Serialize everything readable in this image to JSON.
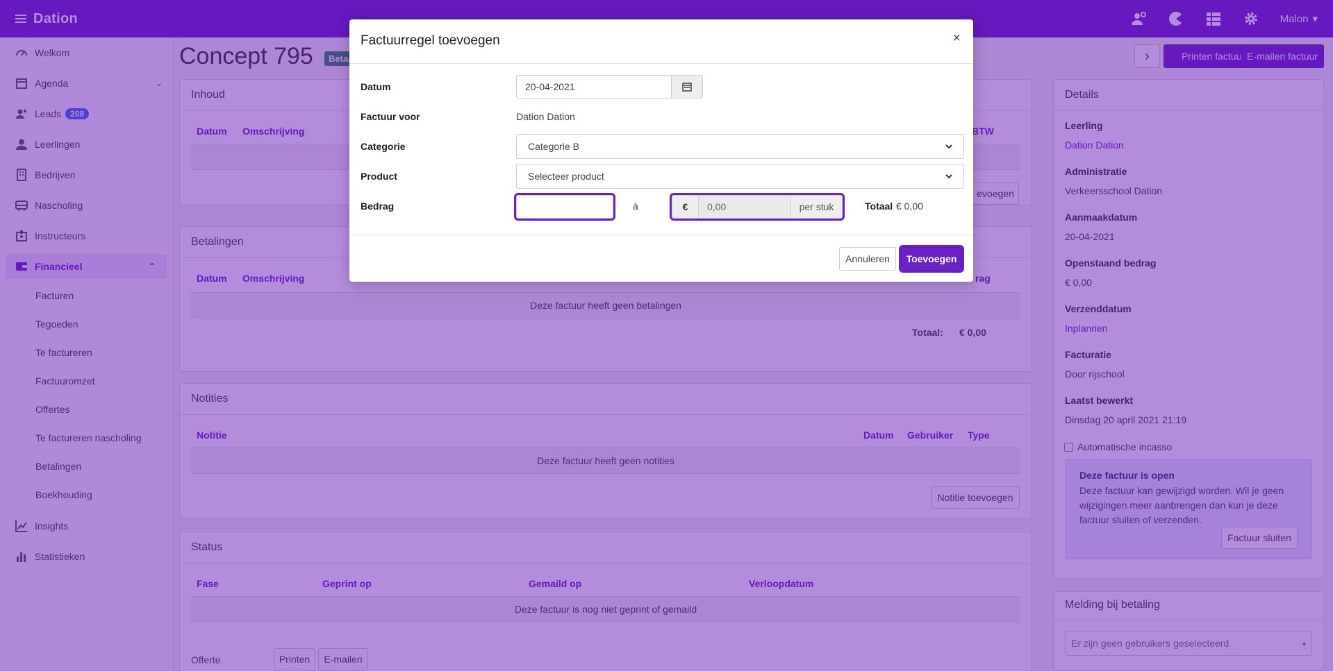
{
  "app": {
    "brand": "Dation",
    "user": "Malon"
  },
  "icons": {
    "menu": "hamburger-icon",
    "top": [
      "user-settings-icon",
      "pacman-icon",
      "grid-list-icon",
      "gear-icon"
    ]
  },
  "sidebar": {
    "items": [
      {
        "label": "Welkom",
        "icon": "dashboard-icon"
      },
      {
        "label": "Agenda",
        "icon": "calendar-icon"
      },
      {
        "label": "Leads",
        "icon": "user-star-icon",
        "badge": "208"
      },
      {
        "label": "Leerlingen",
        "icon": "person-icon"
      },
      {
        "label": "Bedrijven",
        "icon": "building-icon"
      },
      {
        "label": "Nascholing",
        "icon": "bus-icon"
      },
      {
        "label": "Instructeurs",
        "icon": "id-badge-icon"
      },
      {
        "label": "Financieel",
        "icon": "wallet-icon"
      },
      {
        "label": "Insights",
        "icon": "line-chart-icon"
      },
      {
        "label": "Statistieken",
        "icon": "bar-chart-icon"
      }
    ],
    "financieel_sub": [
      "Facturen",
      "Tegoeden",
      "Te factureren",
      "Factuuromzet",
      "Offertes",
      "Te factureren nascholing",
      "Betalingen",
      "Boekhouding"
    ]
  },
  "page": {
    "title": "Concept 795",
    "badge": "Betaald",
    "buttons": {
      "next": "›",
      "print": "Printen factuur",
      "email": "E-mailen factuur"
    }
  },
  "inhoud": {
    "title": "Inhoud",
    "headers": {
      "datum": "Datum",
      "omschrijving": "Omschrijving",
      "btw": "BTW"
    },
    "add_button": "evoegen"
  },
  "betalingen": {
    "title": "Betalingen",
    "headers": {
      "datum": "Datum",
      "omschrijving": "Omschrijving",
      "bedrag": "rag"
    },
    "empty": "Deze factuur heeft geen betalingen",
    "total_label": "Totaal:",
    "total_value": "€ 0,00"
  },
  "notities": {
    "title": "Notities",
    "headers": {
      "notitie": "Notitie",
      "datum": "Datum",
      "gebruiker": "Gebruiker",
      "type": "Type"
    },
    "empty": "Deze factuur heeft geen notities",
    "add_button": "Notitie toevoegen"
  },
  "status": {
    "title": "Status",
    "headers": {
      "fase": "Fase",
      "geprint": "Geprint op",
      "gemaild": "Gemaild op",
      "verloop": "Verloopdatum"
    },
    "empty": "Deze factuur is nog niet geprint of gemaild",
    "offerte_label": "Offerte",
    "print_btn": "Printen",
    "email_btn": "E-mailen"
  },
  "details": {
    "title": "Details",
    "fields": [
      {
        "label": "Leerling",
        "value": "Dation Dation",
        "link": true
      },
      {
        "label": "Administratie",
        "value": "Verkeersschool Dation",
        "link": false
      },
      {
        "label": "Aanmaakdatum",
        "value": "20-04-2021",
        "link": false
      },
      {
        "label": "Openstaand bedrag",
        "value": "€ 0,00",
        "link": false
      },
      {
        "label": "Verzenddatum",
        "value": "Inplannen",
        "link": true
      },
      {
        "label": "Facturatie",
        "value": "Door rijschool",
        "link": false
      },
      {
        "label": "Laatst bewerkt",
        "value": "Dinsdag 20 april 2021 21:19",
        "link": false
      }
    ],
    "incasso_label": "Automatische incasso",
    "alert_title": "Deze factuur is open",
    "alert_text": "Deze factuur kan gewijzigd worden. Wil je geen wijzigingen meer aanbrengen dan kun je deze factuur sluiten of verzenden.",
    "close_button": "Factuur sluiten"
  },
  "melding": {
    "title": "Melding bij betaling",
    "placeholder": "Er zijn geen gebruikers geselecteerd"
  },
  "modal": {
    "title": "Factuurregel toevoegen",
    "close": "×",
    "datum_label": "Datum",
    "datum_value": "20-04-2021",
    "factuur_voor_label": "Factuur voor",
    "factuur_voor_value": "Dation Dation",
    "categorie_label": "Categorie",
    "categorie_value": "Categorie B",
    "product_label": "Product",
    "product_value": "Selecteer product",
    "bedrag_label": "Bedrag",
    "bedrag_quantity": "",
    "a_label": "à",
    "currency": "€",
    "price_placeholder": "0,00",
    "per_unit": "per stuk",
    "totaal_label": "Totaal",
    "totaal_value": "€ 0,00",
    "cancel": "Annuleren",
    "submit": "Toevoegen"
  },
  "colors": {
    "brand": "#6a22c7",
    "overlay": "#6010b4",
    "badge_blue": "#3d6ee8",
    "badge_green": "#2f8a5a"
  }
}
